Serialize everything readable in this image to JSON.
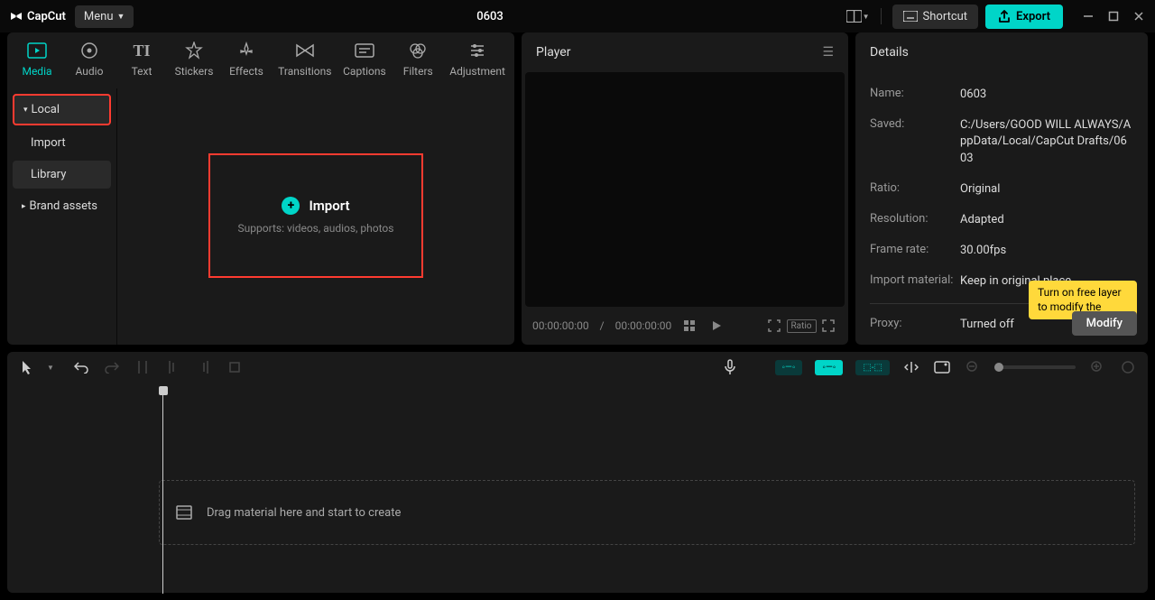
{
  "app": {
    "name": "CapCut",
    "project_title": "0603"
  },
  "titlebar": {
    "menu_label": "Menu",
    "shortcut_label": "Shortcut",
    "export_label": "Export"
  },
  "media_tabs": [
    {
      "label": "Media"
    },
    {
      "label": "Audio"
    },
    {
      "label": "Text"
    },
    {
      "label": "Stickers"
    },
    {
      "label": "Effects"
    },
    {
      "label": "Transitions"
    },
    {
      "label": "Captions"
    },
    {
      "label": "Filters"
    },
    {
      "label": "Adjustment"
    }
  ],
  "media_sidebar": {
    "local": "Local",
    "import": "Import",
    "library": "Library",
    "brand_assets": "Brand assets"
  },
  "import_zone": {
    "title": "Import",
    "subtitle": "Supports: videos, audios, photos"
  },
  "player": {
    "title": "Player",
    "time_current": "00:00:00:00",
    "time_total": "00:00:00:00",
    "ratio_label": "Ratio"
  },
  "details": {
    "title": "Details",
    "name_label": "Name:",
    "name_value": "0603",
    "saved_label": "Saved:",
    "saved_value": "C:/Users/GOOD WILL ALWAYS/AppData/Local/CapCut Drafts/0603",
    "ratio_label": "Ratio:",
    "ratio_value": "Original",
    "resolution_label": "Resolution:",
    "resolution_value": "Adapted",
    "framerate_label": "Frame rate:",
    "framerate_value": "30.00fps",
    "import_material_label": "Import material:",
    "import_material_value": "Keep in original place",
    "proxy_label": "Proxy:",
    "proxy_value": "Turned off",
    "tooltip_text": "Turn on free layer to modify the",
    "modify_label": "Modify"
  },
  "timeline": {
    "hint": "Drag material here and start to create"
  }
}
